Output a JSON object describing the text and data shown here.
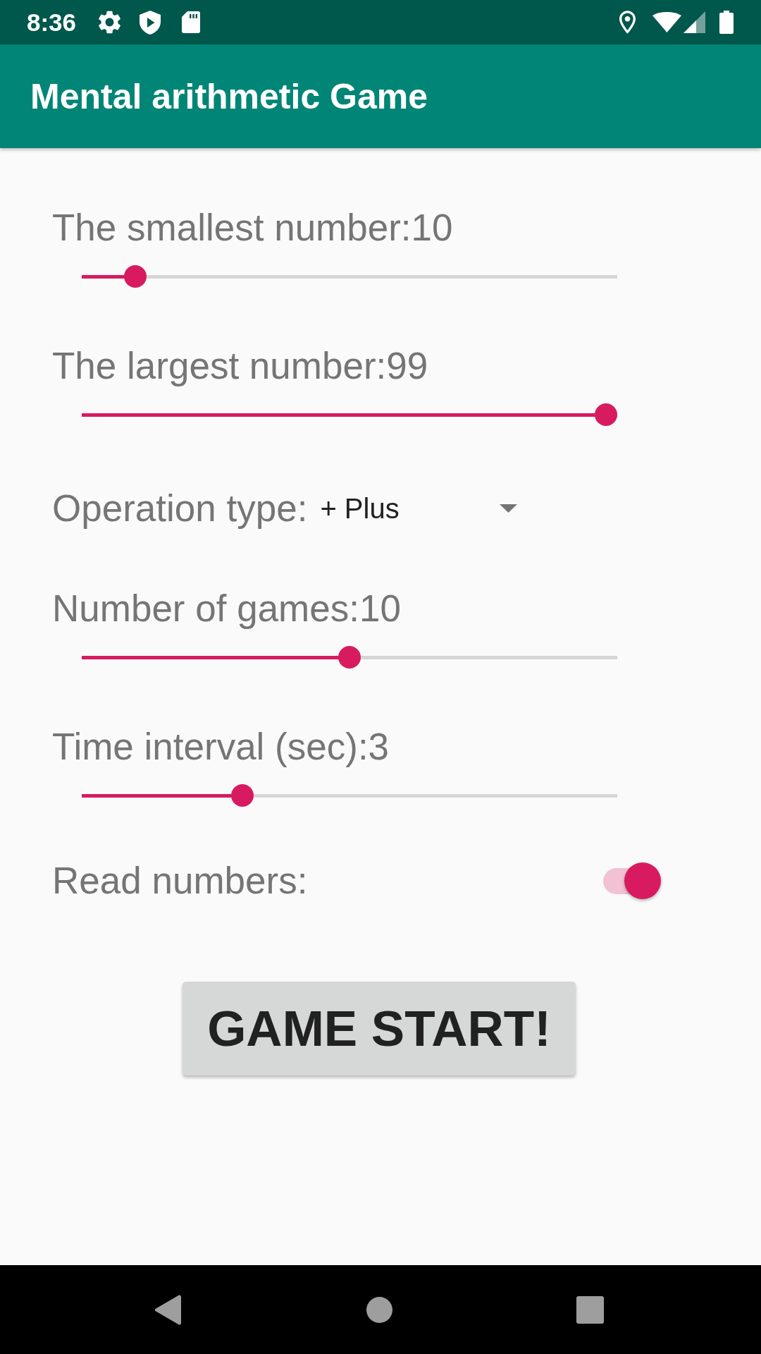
{
  "status_bar": {
    "time": "8:36"
  },
  "app_bar": {
    "title": "Mental arithmetic Game"
  },
  "settings": [
    {
      "kind": "slider",
      "label": "The smallest number:10",
      "level": 0.1
    },
    {
      "kind": "slider",
      "label": "The largest number:99",
      "level": 1
    },
    {
      "kind": "dropdown",
      "label": "Operation type:",
      "value": "+ Plus"
    },
    {
      "kind": "slider",
      "label": "Number of games:10",
      "level": 0.5
    },
    {
      "kind": "slider",
      "label": "Time interval (sec):3",
      "level": 0.3
    },
    {
      "kind": "switch",
      "label": "Read numbers:",
      "on": true
    }
  ],
  "start_button": {
    "label": "GAME START!"
  }
}
